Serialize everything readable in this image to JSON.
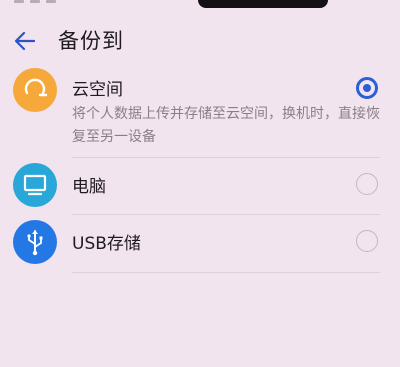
{
  "header": {
    "title": "备份到",
    "back_icon": "arrow-left-icon"
  },
  "options": [
    {
      "label": "云空间",
      "description": "将个人数据上传并存储至云空间，换机时，直接恢复至另一设备",
      "icon": "cloud-sync-icon",
      "icon_color": "#f6a83a",
      "selected": true
    },
    {
      "label": "电脑",
      "icon": "computer-monitor-icon",
      "icon_color": "#28a7d8",
      "selected": false
    },
    {
      "label": "USB存储",
      "icon": "usb-icon",
      "icon_color": "#2478e6",
      "selected": false
    }
  ],
  "colors": {
    "background": "#f1e4ee",
    "accent": "#2a5fd6",
    "text_primary": "#1f1b20",
    "text_secondary": "#8a7f88"
  }
}
